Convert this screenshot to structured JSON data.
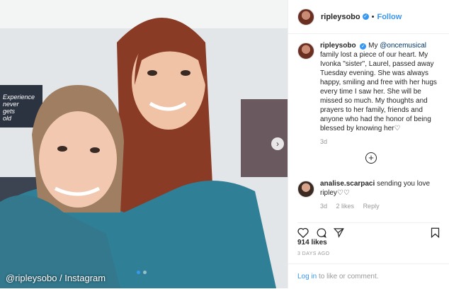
{
  "photo": {
    "watermark": "@ripleysobo / Instagram",
    "poster_text": [
      "Experience",
      "never",
      "gets",
      "old"
    ],
    "next_icon": "chevron-right-icon",
    "carousel_dots": 2
  },
  "header": {
    "username": "ripleysobo",
    "verified_icon": "verified-badge-icon",
    "separator": "•",
    "follow_label": "Follow"
  },
  "caption": {
    "username": "ripleysobo",
    "text_before": "My ",
    "mention": "@oncemusical",
    "text_after": " family lost a piece of our heart. My Ivonka \"sister\", Laurel, passed away Tuesday evening. She was always happy, smiling and free with her hugs every time I saw her. She will be missed so much. My thoughts and prayers to her family, friends and anyone who had the honor of being blessed by knowing her♡",
    "age": "3d"
  },
  "load_more_icon": "plus-circle-icon",
  "comment": {
    "username": "analise.scarpaci",
    "text": "sending you love ripley♡♡",
    "age": "3d",
    "likes": "2 likes",
    "reply": "Reply"
  },
  "likes": "914 likes",
  "date": "3 DAYS AGO",
  "login": {
    "link": "Log in",
    "text": " to like or comment."
  },
  "colors": {
    "accent": "#3897f0",
    "text": "#262626",
    "muted": "#999999"
  }
}
